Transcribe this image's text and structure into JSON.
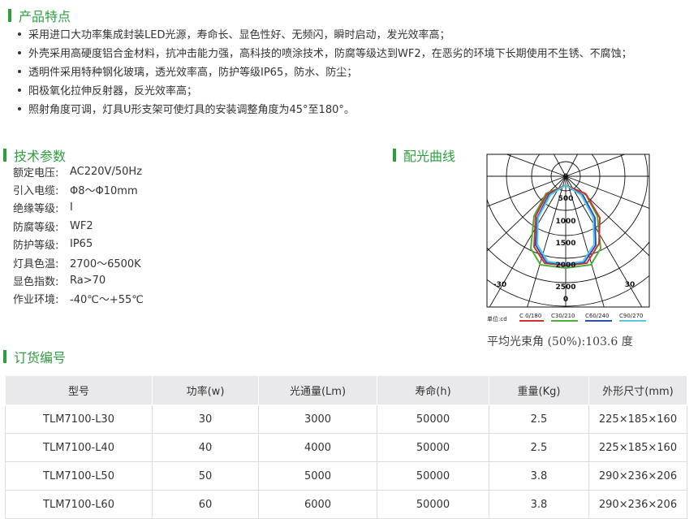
{
  "sections": {
    "features_title": "产品特点",
    "params_title": "技术参数",
    "curve_title": "配光曲线",
    "order_title": "订货编号"
  },
  "features": [
    "采用进口大功率集成封装LED光源，寿命长、显色性好、无频闪，瞬时启动，发光效率高；",
    "外壳采用高硬度铝合金材料，抗冲击能力强，高科技的喷涂技术，防腐等级达到WF2，在恶劣的环境下长期使用不生锈、不腐蚀；",
    "透明件采用特种钢化玻璃，透光效率高，防护等级IP65，防水、防尘；",
    "阳极氧化拉伸反射器，反光效率高；",
    "照射角度可调，灯具U形支架可使灯具的安装调整角度为45°至180°。"
  ],
  "params": [
    {
      "label": "额定电压:",
      "value": "AC220V/50Hz"
    },
    {
      "label": "引入电缆:",
      "value": "Φ8～Φ10mm"
    },
    {
      "label": "绝缘等级:",
      "value": "I"
    },
    {
      "label": "防腐等级:",
      "value": "WF2"
    },
    {
      "label": "防护等级:",
      "value": "IP65"
    },
    {
      "label": "灯具色温:",
      "value": "2700～6500K"
    },
    {
      "label": "显色指数:",
      "value": "Ra>70"
    },
    {
      "label": "作业环境:",
      "value": "-40℃～+55℃"
    }
  ],
  "polar": {
    "ring_labels": [
      "0",
      "500",
      "1000",
      "1500",
      "2000",
      "2500"
    ],
    "angle_left": "-30",
    "angle_right": "30",
    "zero_label": "0",
    "unit_label": "单位:cd",
    "legend": [
      {
        "label": "C 0/180",
        "color": "#d2312b"
      },
      {
        "label": "C30/210",
        "color": "#4caf3a"
      },
      {
        "label": "C60/240",
        "color": "#2a4fb0"
      },
      {
        "label": "C90/270",
        "color": "#5bc6e0"
      }
    ],
    "caption": "平均光束角 (50%):103.6 度"
  },
  "order_table": {
    "headers": [
      "型号",
      "功率(w)",
      "光通量(Lm)",
      "寿命(h)",
      "重量(Kg)",
      "外形尺寸(mm)"
    ],
    "rows": [
      [
        "TLM7100-L30",
        "30",
        "3000",
        "50000",
        "2.5",
        "225×185×160"
      ],
      [
        "TLM7100-L40",
        "40",
        "4000",
        "50000",
        "2.5",
        "225×185×160"
      ],
      [
        "TLM7100-L50",
        "50",
        "5000",
        "50000",
        "3.8",
        "290×236×206"
      ],
      [
        "TLM7100-L60",
        "60",
        "6000",
        "50000",
        "3.8",
        "290×236×206"
      ]
    ]
  },
  "colors": {
    "accent": "#2e9e3f",
    "header_bg": "#e9e9eb"
  }
}
